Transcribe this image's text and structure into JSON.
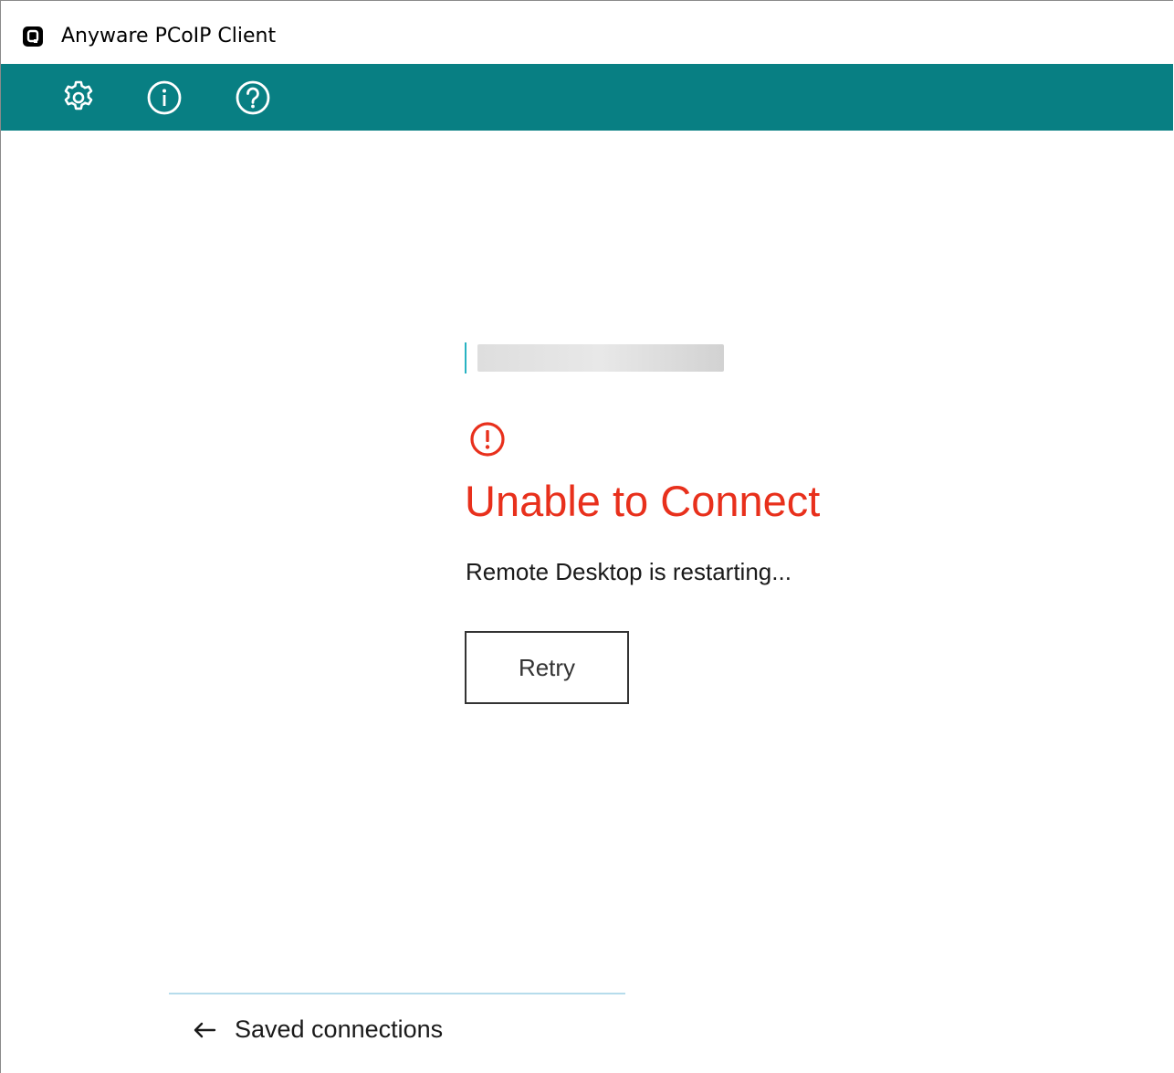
{
  "window": {
    "title": "Anyware PCoIP Client",
    "app_icon": "teradici-app-icon"
  },
  "toolbar": {
    "accent_color": "#087f83",
    "buttons": [
      {
        "icon": "gear-icon",
        "label": "Settings"
      },
      {
        "icon": "info-icon",
        "label": "About"
      },
      {
        "icon": "help-icon",
        "label": "Help"
      }
    ]
  },
  "connection": {
    "name_redacted": true
  },
  "error": {
    "icon": "error-circle-icon",
    "title": "Unable to Connect",
    "message": "Remote Desktop is restarting...",
    "color": "#e8301c"
  },
  "actions": {
    "retry_label": "Retry"
  },
  "footer": {
    "back_icon": "arrow-left-icon",
    "saved_connections_label": "Saved connections"
  }
}
